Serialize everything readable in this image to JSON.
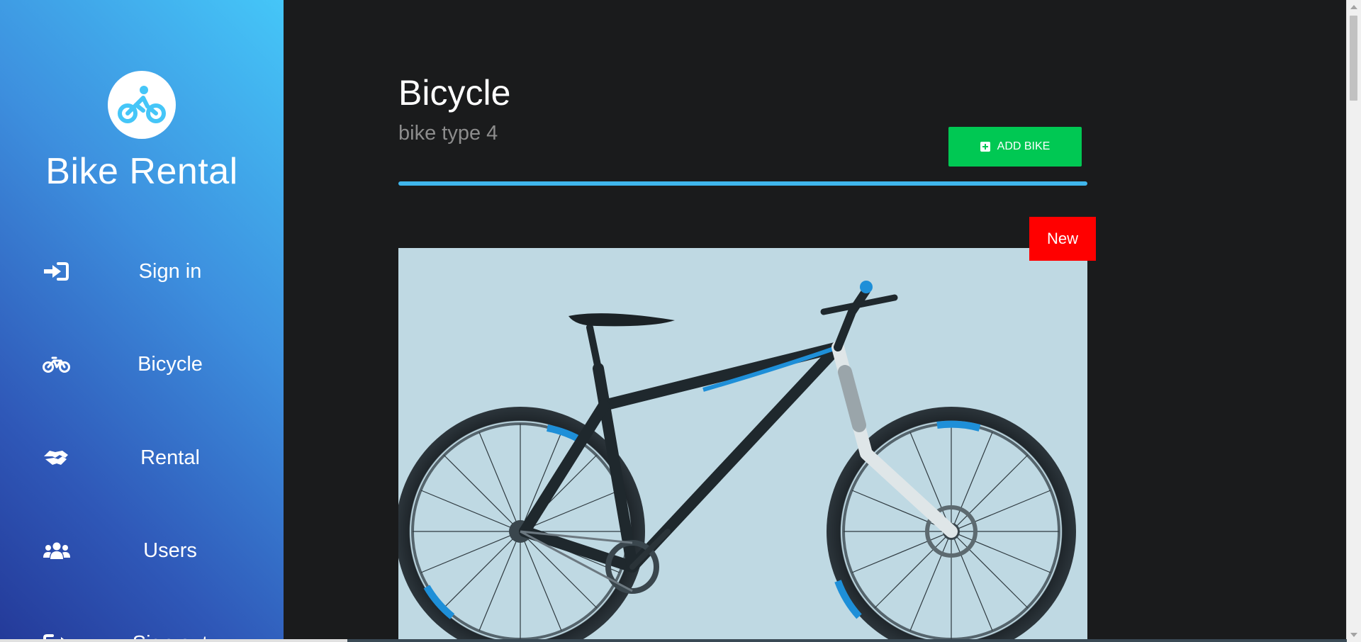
{
  "app": {
    "brand": "Bike Rental",
    "logo_icon": "cyclist-icon",
    "accent_color": "#45c6f8"
  },
  "sidebar": {
    "items": [
      {
        "label": "Sign in",
        "icon": "sign-in-icon"
      },
      {
        "label": "Bicycle",
        "icon": "bicycle-icon"
      },
      {
        "label": "Rental",
        "icon": "handshake-icon"
      },
      {
        "label": "Users",
        "icon": "users-icon"
      },
      {
        "label": "Sign out",
        "icon": "sign-out-icon"
      }
    ]
  },
  "main": {
    "title": "Bicycle",
    "subtitle": "bike type 4",
    "add_button": {
      "label": "ADD BIKE",
      "icon": "plus-square-icon",
      "color": "#00c853"
    },
    "divider_color": "#3fb6ec",
    "card": {
      "badge": "New",
      "badge_color": "#ff0000",
      "image": "mountain-bike-photo"
    }
  }
}
